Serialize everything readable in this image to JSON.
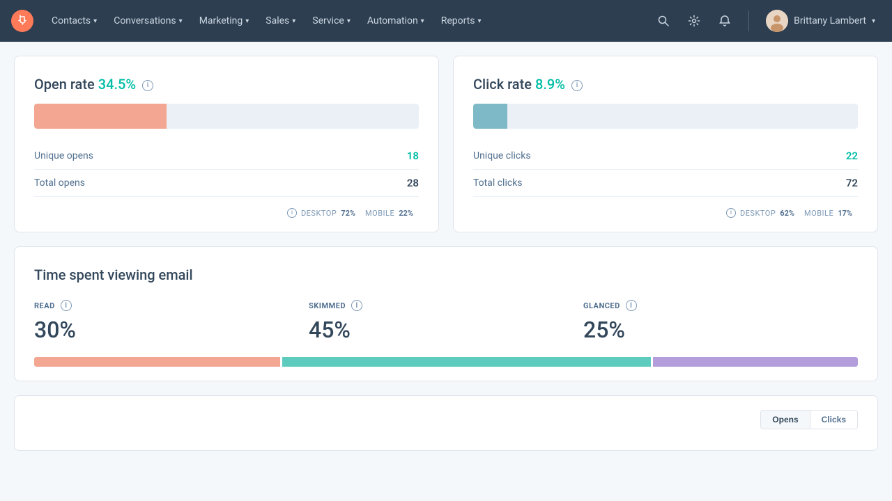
{
  "nav": {
    "items": [
      {
        "label": "Contacts",
        "id": "contacts"
      },
      {
        "label": "Conversations",
        "id": "conversations"
      },
      {
        "label": "Marketing",
        "id": "marketing"
      },
      {
        "label": "Sales",
        "id": "sales"
      },
      {
        "label": "Service",
        "id": "service"
      },
      {
        "label": "Automation",
        "id": "automation"
      },
      {
        "label": "Reports",
        "id": "reports"
      }
    ],
    "user": {
      "name": "Brittany Lambert"
    }
  },
  "open_rate_card": {
    "title": "Open rate",
    "rate": "34.5%",
    "fill_percent": 34.5,
    "unique_opens_label": "Unique opens",
    "unique_opens_value": "18",
    "total_opens_label": "Total opens",
    "total_opens_value": "28",
    "footer_desktop_label": "DESKTOP",
    "footer_desktop_val": "72%",
    "footer_mobile_label": "MOBILE",
    "footer_mobile_val": "22%"
  },
  "click_rate_card": {
    "title": "Click rate",
    "rate": "8.9%",
    "fill_percent": 8.9,
    "unique_clicks_label": "Unique clicks",
    "unique_clicks_value": "22",
    "total_clicks_label": "Total clicks",
    "total_clicks_value": "72",
    "footer_desktop_label": "DESKTOP",
    "footer_desktop_val": "62%",
    "footer_mobile_label": "MOBILE",
    "footer_mobile_val": "17%"
  },
  "time_card": {
    "title": "Time spent viewing email",
    "read_label": "READ",
    "read_value": "30%",
    "read_percent": 30,
    "skimmed_label": "SKIMMED",
    "skimmed_value": "45%",
    "skimmed_percent": 45,
    "glanced_label": "GLANCED",
    "glanced_value": "25%",
    "glanced_percent": 25
  },
  "bottom_card": {
    "opens_btn": "Opens",
    "clicks_btn": "Clicks"
  },
  "icons": {
    "info": "i",
    "search": "🔍",
    "settings": "⚙",
    "notifications": "🔔",
    "chevron": "▾"
  }
}
